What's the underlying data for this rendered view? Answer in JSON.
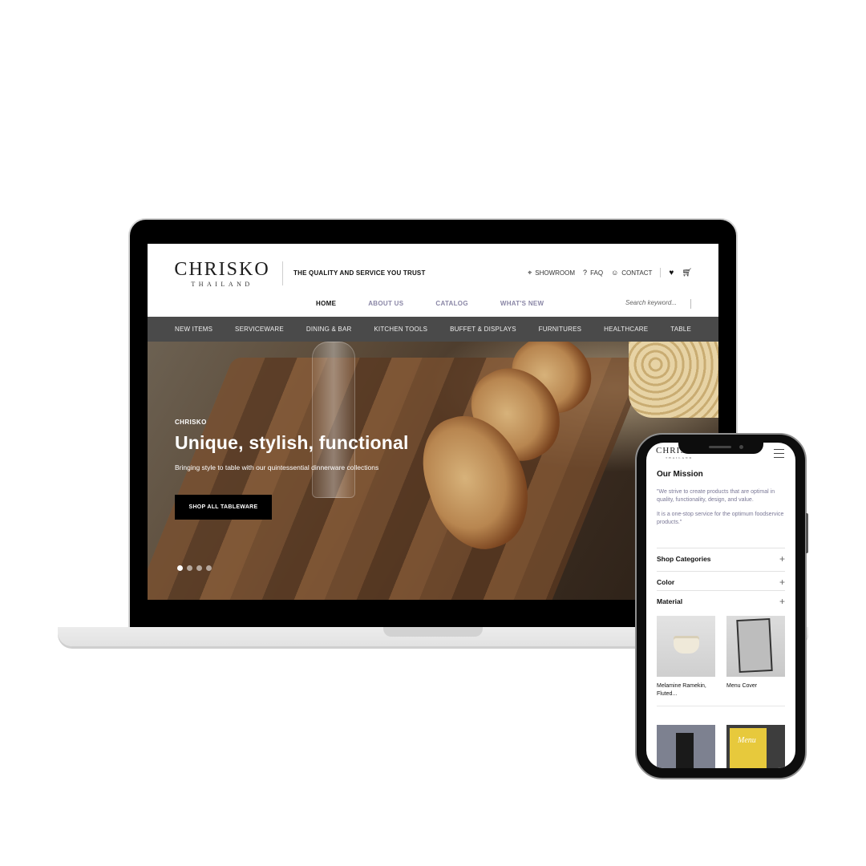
{
  "brand": {
    "name": "CHRISKO",
    "sub": "THAILAND"
  },
  "header": {
    "tagline": "THE QUALITY AND SERVICE YOU TRUST",
    "util": {
      "showroom": "SHOWROOM",
      "faq": "FAQ",
      "contact": "CONTACT"
    },
    "search_placeholder": "Search keyword..."
  },
  "main_nav": [
    {
      "label": "HOME",
      "active": true
    },
    {
      "label": "ABOUT US",
      "active": false
    },
    {
      "label": "CATALOG",
      "active": false
    },
    {
      "label": "WHAT'S NEW",
      "active": false
    }
  ],
  "categories": [
    "NEW ITEMS",
    "SERVICEWARE",
    "DINING & BAR",
    "KITCHEN TOOLS",
    "BUFFET & DISPLAYS",
    "FURNITURES",
    "HEALTHCARE",
    "TABLE"
  ],
  "hero": {
    "eyebrow": "CHRISKO",
    "title": "Unique, stylish, functional",
    "subtitle": "Bringing style to table with our quintessential dinnerware collections",
    "cta": "SHOP ALL TABLEWARE",
    "slides_total": 4,
    "active_slide": 1
  },
  "mobile": {
    "logo": "CHRISKO",
    "logo_sub": "THAILAND",
    "mission_title": "Our Mission",
    "mission_p1": "\"We strive to create products that are optimal in quality, functionality, design, and value.",
    "mission_p2": "It is a one-stop service for the optimum foodservice products.\"",
    "accordions": [
      "Shop Categories",
      "Color",
      "Material"
    ],
    "products": [
      {
        "name": "Melamine Ramekin, Fluted..."
      },
      {
        "name": "Menu Cover"
      }
    ],
    "menu_book_text": "Menu"
  },
  "colors": {
    "nav_bar": "#4a4a4a",
    "nav_inactive": "#8a86a6",
    "cta_bg": "#000000",
    "mission_text": "#7a7896"
  }
}
